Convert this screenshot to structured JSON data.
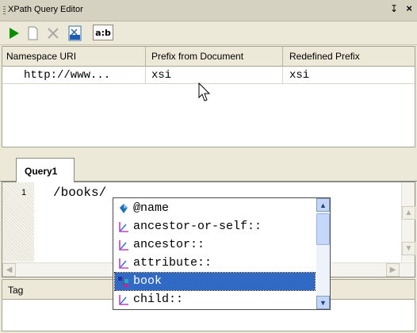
{
  "window": {
    "title": "XPath Query Editor",
    "pin_glyph": "↧",
    "close_glyph": "×"
  },
  "toolbar": {
    "buttons": [
      {
        "name": "run-icon"
      },
      {
        "name": "new-icon"
      },
      {
        "name": "delete-icon"
      },
      {
        "name": "xml-icon",
        "glyph": "XML"
      },
      {
        "name": "namespace-toggle",
        "label": "a:b"
      }
    ]
  },
  "namespaces": {
    "headers": [
      "Namespace URI",
      "Prefix from Document",
      "Redefined Prefix"
    ],
    "rows": [
      [
        "http://www...",
        "xsi",
        "xsi"
      ]
    ]
  },
  "tabs": [
    {
      "label": "Query1"
    }
  ],
  "editor": {
    "line_number": "1",
    "text": "/books/"
  },
  "autocomplete": {
    "items": [
      {
        "label": "@name",
        "icon": "attribute-icon"
      },
      {
        "label": "ancestor-or-self::",
        "icon": "axis-icon"
      },
      {
        "label": "ancestor::",
        "icon": "axis-icon"
      },
      {
        "label": "attribute::",
        "icon": "axis-icon"
      },
      {
        "label": "book",
        "icon": "element-icon",
        "selected": true
      },
      {
        "label": "child::",
        "icon": "axis-icon"
      }
    ]
  },
  "results": {
    "header": "Tag"
  },
  "colors": {
    "selection": "#316ac5",
    "run": "#009000",
    "axis_icon": "#c040c0",
    "attribute_icon": "#1b6fb8"
  }
}
